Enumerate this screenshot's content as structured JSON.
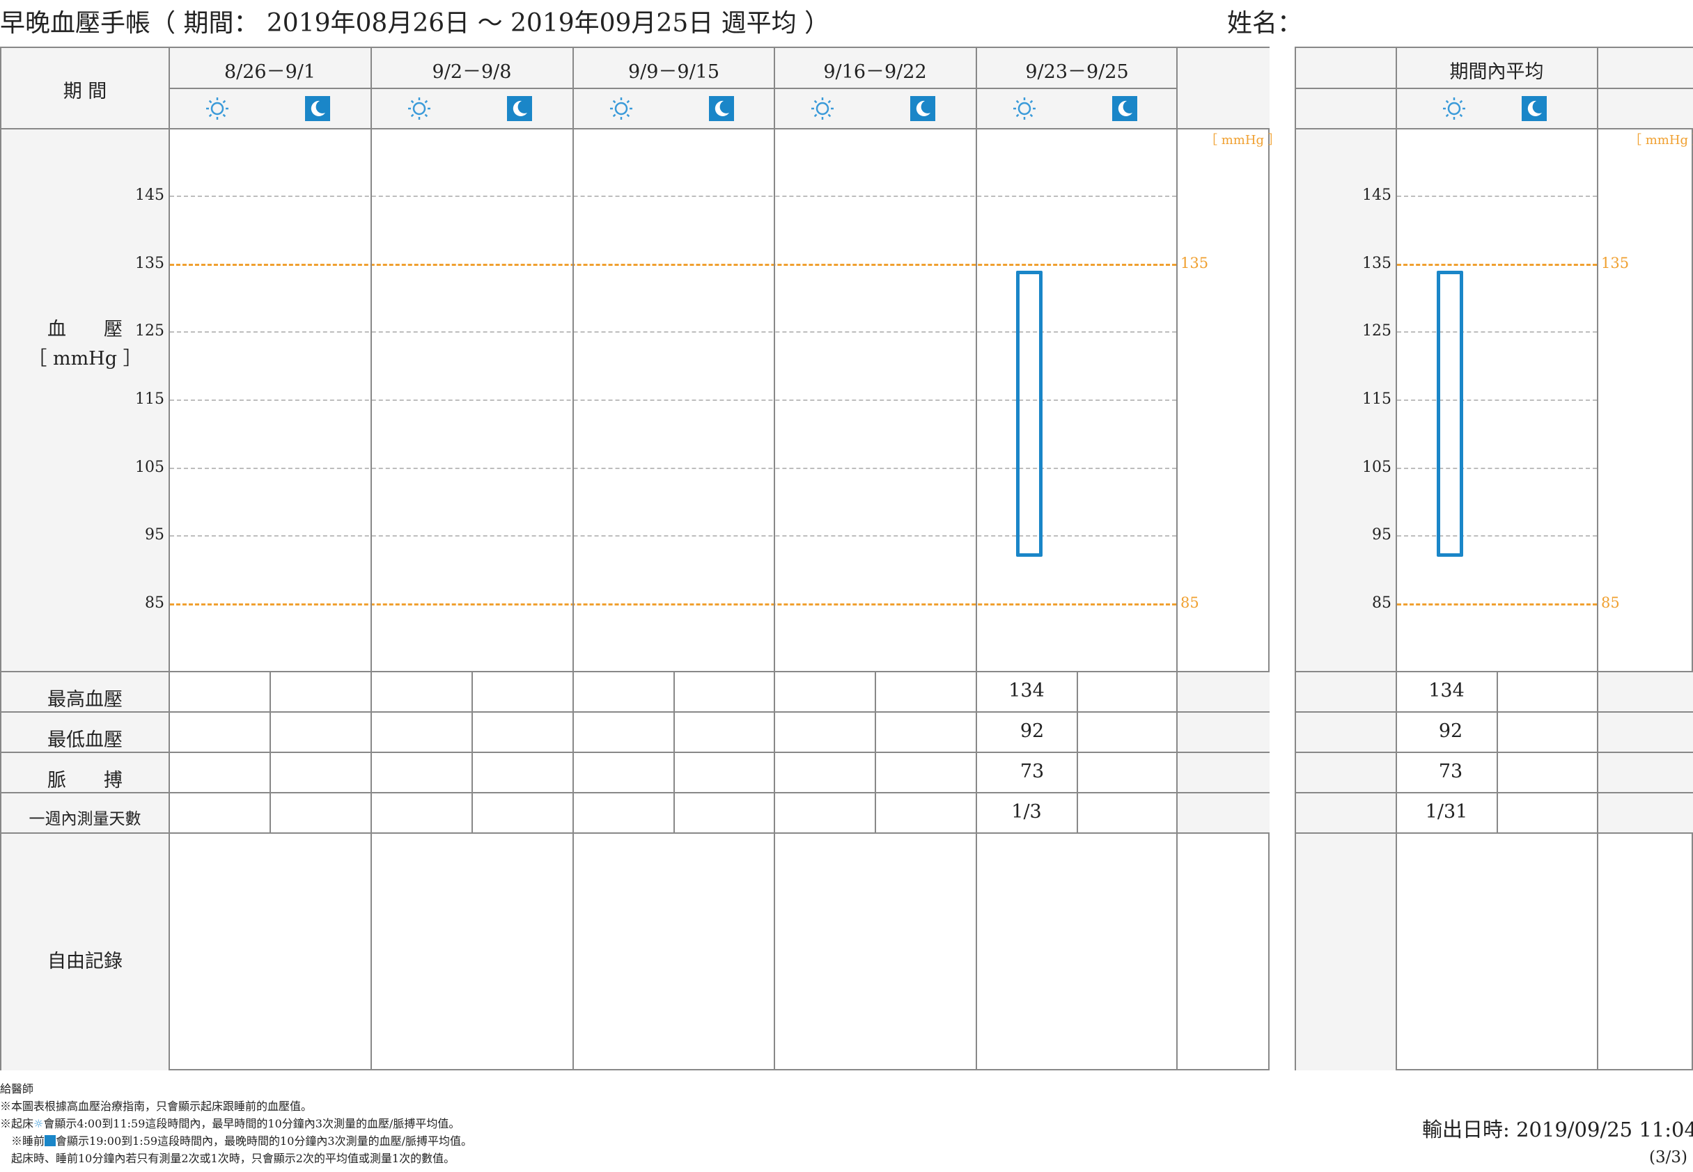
{
  "header": {
    "title": "早晚血壓手帳（ 期間： 2019年08月26日 ～ 2019年09月25日 週平均 ）",
    "name_label": "姓名："
  },
  "left": {
    "period_label": "期 間",
    "weeks": [
      "8/26－9/1",
      "9/2－9/8",
      "9/9－9/15",
      "9/16－9/22",
      "9/23－9/25"
    ],
    "bp_label_line1": "血　　壓",
    "bp_label_line2": "［ mmHg ］",
    "unit": "［ mmHg ］",
    "rows": {
      "systolic_label": "最高血壓",
      "diastolic_label": "最低血壓",
      "pulse_label": "脈　　搏",
      "days_label": "一週內測量天數",
      "memo_label": "自由記錄"
    },
    "values": {
      "week5_morning_systolic": "134",
      "week5_morning_diastolic": "92",
      "week5_morning_pulse": "73",
      "week5_morning_days": "1/3"
    }
  },
  "right": {
    "title": "期間內平均",
    "unit": "［ mmHg ］",
    "values": {
      "morning_systolic": "134",
      "morning_diastolic": "92",
      "morning_pulse": "73",
      "morning_days": "1/31"
    }
  },
  "chart_data": {
    "type": "bar",
    "ylabel": "血壓 ［ mmHg ］",
    "y_ticks": [
      145,
      135,
      125,
      115,
      105,
      95,
      85
    ],
    "ylim": [
      77,
      155
    ],
    "reference_lines": [
      {
        "label": "135",
        "value": 135,
        "color": "#f0a030"
      },
      {
        "label": "85",
        "value": 85,
        "color": "#f0a030"
      }
    ],
    "series": [
      {
        "name": "起床",
        "values": [
          null,
          null,
          null,
          null,
          [
            92,
            134
          ]
        ]
      },
      {
        "name": "睡前",
        "values": [
          null,
          null,
          null,
          null,
          null
        ]
      }
    ],
    "categories": [
      "8/26－9/1",
      "9/2－9/8",
      "9/9－9/15",
      "9/16－9/22",
      "9/23－9/25"
    ],
    "period_average": {
      "起床": [
        92,
        134
      ],
      "睡前": null
    },
    "bar_color": "#1a86c8"
  },
  "footer": {
    "line1": "給醫師",
    "line2": "※本圖表根據高血壓治療指南，只會顯示起床跟睡前的血壓值。",
    "line3_a": "※起床",
    "line3_b": "會顯示4:00到11:59這段時間內，最早時間的10分鐘內3次測量的血壓/脈搏平均值。",
    "line4_a": "※睡前",
    "line4_b": "會顯示19:00到1:59這段時間內，最晚時間的10分鐘內3次測量的血壓/脈搏平均值。",
    "line5": "起床時、睡前10分鐘內若只有測量2次或1次時，只會顯示2次的平均值或測量1次的數值。",
    "output_time": "輸出日時: 2019/09/25 11:04",
    "page": "(3/3)"
  }
}
